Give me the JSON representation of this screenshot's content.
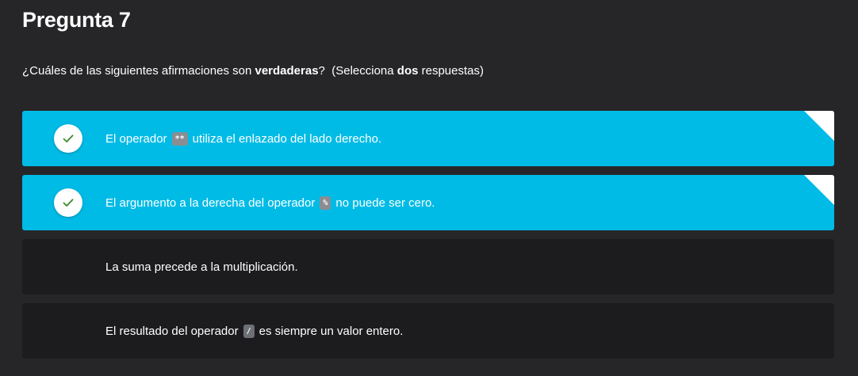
{
  "question": {
    "title": "Pregunta 7",
    "instruction_part1": "¿Cuáles de las siguientes afirmaciones son ",
    "instruction_bold1": "verdaderas",
    "instruction_part2": "?  (Selecciona ",
    "instruction_bold2": "dos",
    "instruction_part3": " respuestas)"
  },
  "options": [
    {
      "selected": true,
      "before": "El operador",
      "code": "**",
      "after": "utiliza el enlazado del lado derecho."
    },
    {
      "selected": true,
      "before": "El argumento a la derecha del operador",
      "code": "%",
      "after": "no puede ser cero."
    },
    {
      "selected": false,
      "text": "La suma precede a la multiplicación."
    },
    {
      "selected": false,
      "before": "El resultado del operador",
      "code": "/",
      "after": "es siempre un valor entero."
    }
  ],
  "colors": {
    "background": "#262629",
    "option_selected": "#00bbe6",
    "option_unselected": "#1c1c1f",
    "check_mark": "#3a8a2e",
    "check_circle": "#ffffff"
  },
  "icons": {
    "check": "check-icon"
  }
}
